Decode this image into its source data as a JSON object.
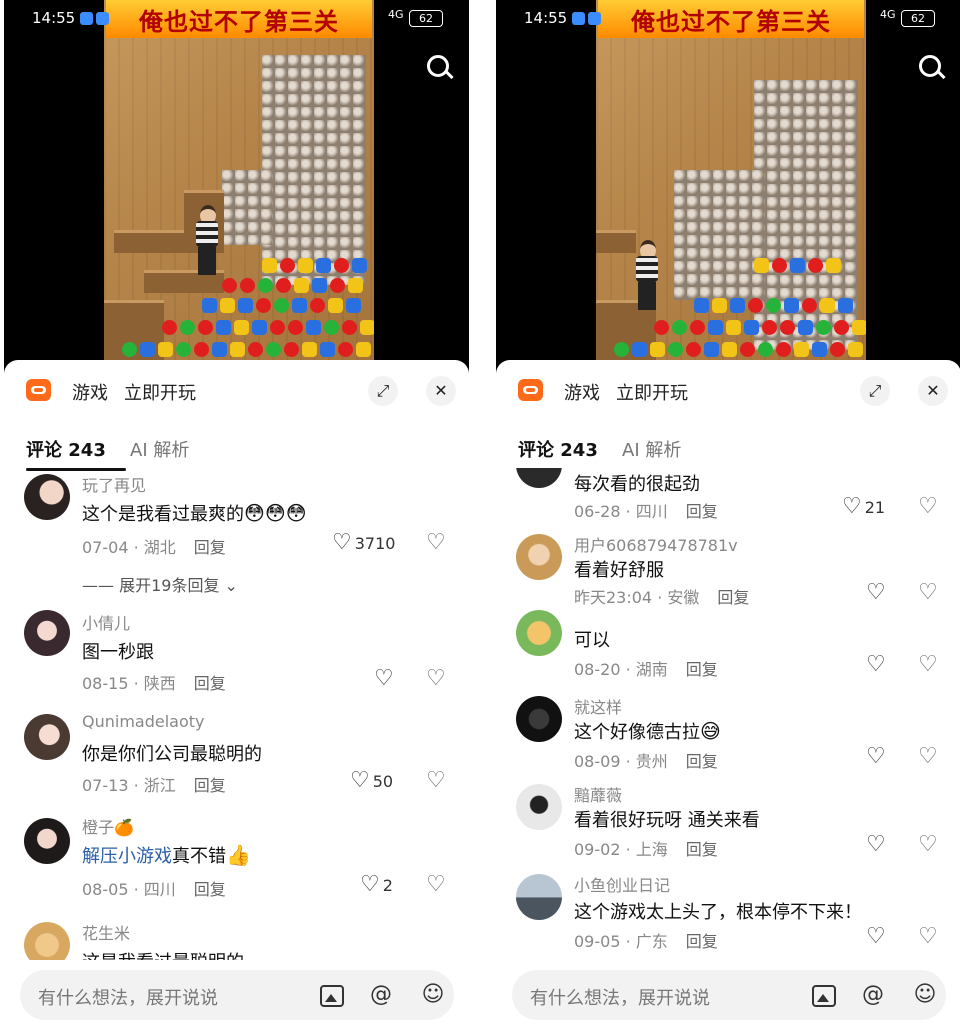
{
  "status": {
    "time": "14:55",
    "signal": "4G",
    "battery": "62"
  },
  "video": {
    "title": "俺也过不了第三关"
  },
  "panel": {
    "header": {
      "label": "游戏",
      "action": "立即开玩"
    },
    "tabs": {
      "comments": "评论 243",
      "ai": "AI 解析"
    },
    "input_placeholder": "有什么想法，展开说说"
  },
  "left_comments": [
    {
      "name": "玩了再见",
      "text": "这个是我看过最爽的",
      "emoji": "😳😳😳",
      "date": "07-04",
      "region": "湖北",
      "reply": "回复",
      "likes": "3710"
    },
    {
      "expand": "展开19条回复"
    },
    {
      "name": "小倩儿",
      "text": "图一秒跟",
      "date": "08-15",
      "region": "陕西",
      "reply": "回复",
      "likes": ""
    },
    {
      "name": "Qunimadelaoty",
      "text": "你是你们公司最聪明的",
      "date": "07-13",
      "region": "浙江",
      "reply": "回复",
      "likes": "50"
    },
    {
      "name": "橙子🍊",
      "link": "解压小游戏",
      "text": "真不错",
      "emoji": "👍",
      "date": "08-05",
      "region": "四川",
      "reply": "回复",
      "likes": "2"
    },
    {
      "name": "花生米",
      "text": "这是我看过最聪明的"
    }
  ],
  "right_comments": [
    {
      "text": "每次看的很起劲",
      "date": "06-28",
      "region": "四川",
      "reply": "回复",
      "likes": "21"
    },
    {
      "name": "用户606879478781v",
      "text": "看着好舒服",
      "date": "昨天23:04",
      "region": "安徽",
      "reply": "回复",
      "likes": ""
    },
    {
      "text": "可以",
      "date": "08-20",
      "region": "湖南",
      "reply": "回复",
      "likes": ""
    },
    {
      "name": "就这样",
      "text": "这个好像德古拉",
      "emoji": "😅",
      "date": "08-09",
      "region": "贵州",
      "reply": "回复",
      "likes": ""
    },
    {
      "name": "黯蘼薇",
      "text": "看着很好玩呀 通关来看",
      "date": "09-02",
      "region": "上海",
      "reply": "回复",
      "likes": ""
    },
    {
      "name": "小鱼创业日记",
      "text": "这个游戏太上头了，根本停不下来！",
      "date": "09-05",
      "region": "广东",
      "reply": "回复",
      "likes": ""
    }
  ],
  "colors": {
    "accent": "#ff6a1a",
    "link": "#2b5fa8"
  },
  "icons": [
    "search-icon",
    "game-icon",
    "expand-icon",
    "close-icon",
    "heart-icon",
    "dislike-icon",
    "image-icon",
    "at-icon",
    "emoji-icon"
  ]
}
